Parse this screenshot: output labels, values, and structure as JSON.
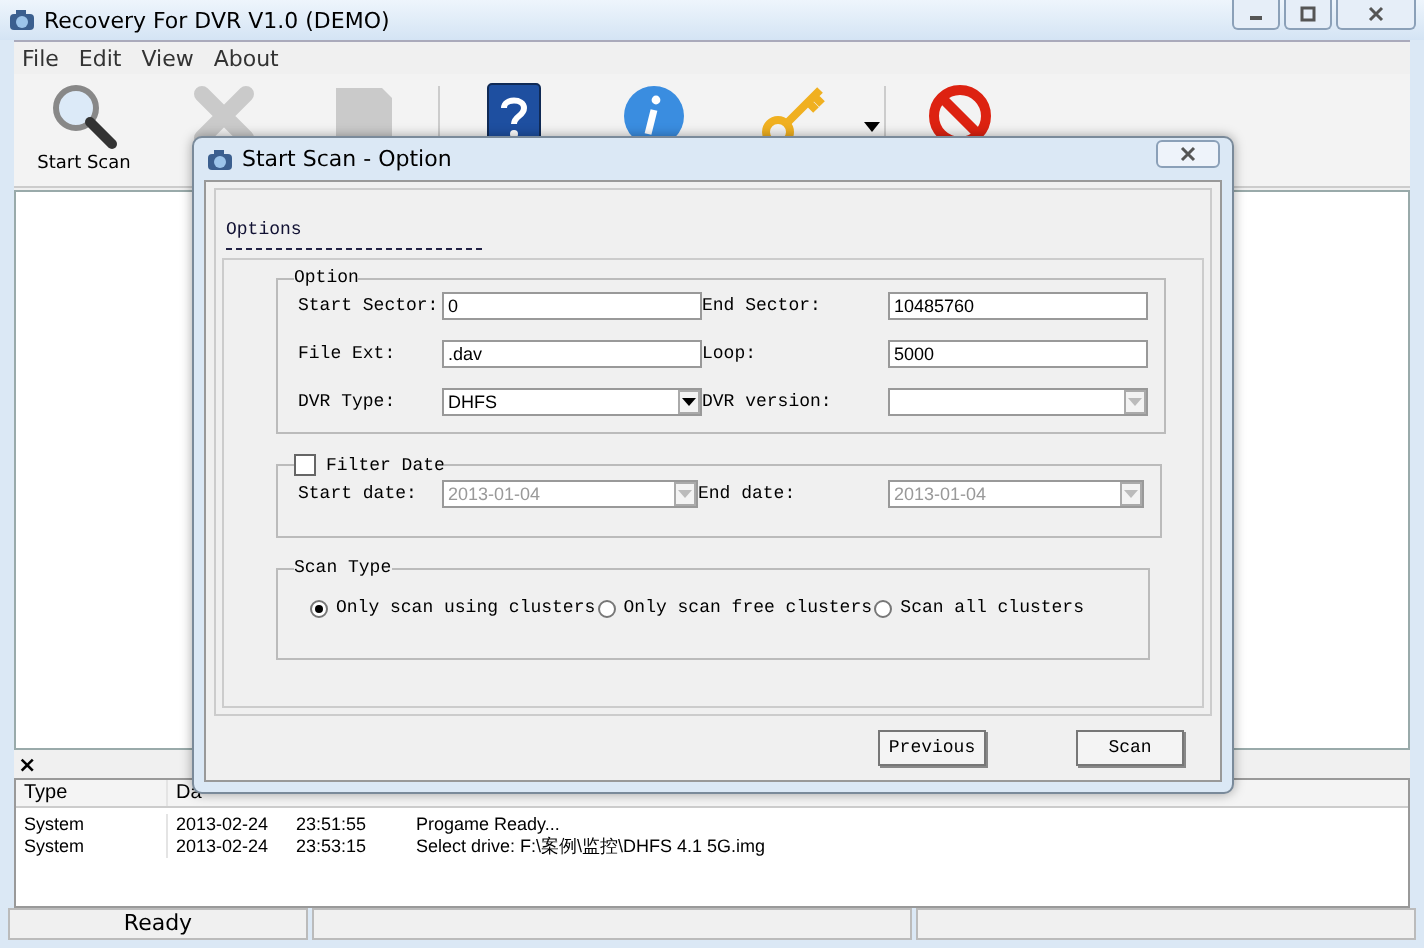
{
  "window": {
    "title": "Recovery For DVR V1.0 (DEMO)"
  },
  "menu": [
    "File",
    "Edit",
    "View",
    "About"
  ],
  "toolbar": [
    {
      "kind": "search",
      "label": "Start Scan",
      "disabled": false
    },
    {
      "kind": "stop",
      "disabled": true
    },
    {
      "kind": "save",
      "disabled": true
    },
    {
      "kind": "help",
      "disabled": false
    },
    {
      "kind": "info",
      "disabled": false
    },
    {
      "kind": "key",
      "disabled": false,
      "dropdown": true
    },
    {
      "kind": "exit",
      "disabled": false
    }
  ],
  "log": {
    "close": "×",
    "columns": [
      "Type",
      "Da"
    ],
    "rows": [
      {
        "cells": [
          "System",
          "2013-02-24",
          "23:51:55",
          "Progame Ready..."
        ]
      },
      {
        "cells": [
          "System",
          "2013-02-24",
          "23:53:15",
          "Select drive: F:\\案例\\监控\\DHFS 4.1 5G.img"
        ]
      }
    ]
  },
  "status_bar": {
    "text": "Ready"
  },
  "dialog": {
    "title": "Start Scan - Option",
    "tab": "Options",
    "option_group": {
      "title": "Option",
      "fields": [
        {
          "label": "Start Sector:",
          "value": "0",
          "kind": "text",
          "disabled": false
        },
        {
          "label": "End Sector:",
          "value": "10485760",
          "kind": "text",
          "disabled": false
        },
        {
          "label": "File Ext:",
          "value": ".dav",
          "kind": "text",
          "disabled": false
        },
        {
          "label": "Loop:",
          "value": "5000",
          "kind": "text",
          "disabled": false
        },
        {
          "label": "DVR Type:",
          "value": "DHFS",
          "kind": "select",
          "disabled": false
        },
        {
          "label": "DVR version:",
          "kind": "select",
          "disabled": true
        }
      ]
    },
    "filter": {
      "label": "Filter Date",
      "checked": false,
      "fields": [
        {
          "label": "Start date:",
          "value": "2013-01-04"
        },
        {
          "label": "End date:",
          "value": "2013-01-04"
        }
      ]
    },
    "scan_type": {
      "title": "Scan Type",
      "options": [
        {
          "label": "Only scan using clusters",
          "selected": true
        },
        {
          "label": "Only scan free clusters",
          "selected": false
        },
        {
          "label": "Scan all clusters",
          "selected": false
        }
      ]
    },
    "buttons": [
      "Previous",
      "Scan"
    ]
  }
}
